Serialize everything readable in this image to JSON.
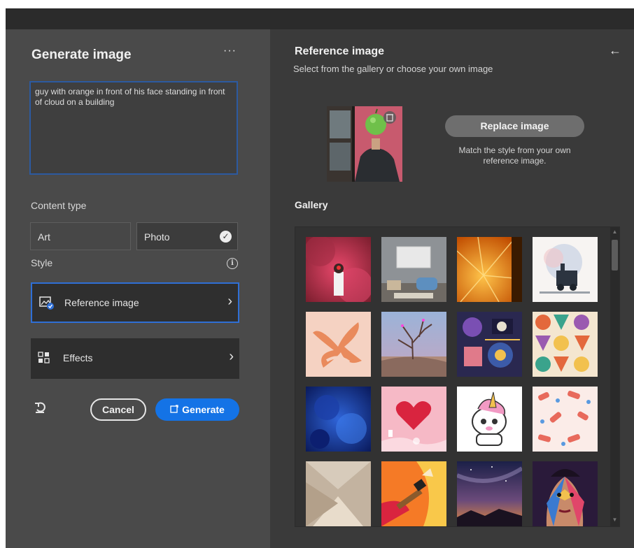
{
  "left_panel": {
    "title": "Generate image",
    "more_label": "···",
    "prompt_text": "guy with orange in front of his face standing in front of cloud on a building",
    "content_type_label": "Content type",
    "content_types": [
      {
        "label": "Art",
        "selected": false
      },
      {
        "label": "Photo",
        "selected": true
      }
    ],
    "style_label": "Style",
    "style_rows": [
      {
        "label": "Reference image",
        "icon": "reference-image-icon",
        "selected": true
      },
      {
        "label": "Effects",
        "icon": "effects-icon",
        "selected": false
      }
    ],
    "cancel_label": "Cancel",
    "generate_label": "Generate",
    "colors": {
      "accent": "#1473e6",
      "selection_border": "#2f6fd6"
    }
  },
  "right_panel": {
    "title": "Reference image",
    "subtitle": "Select from the gallery or choose your own image",
    "back_icon": "arrow-left-icon",
    "replace_label": "Replace image",
    "replace_help": "Match the style from your own reference image.",
    "gallery_label": "Gallery",
    "gallery_items": [
      {
        "name": "smoke-figure"
      },
      {
        "name": "room-interior"
      },
      {
        "name": "orange-slice"
      },
      {
        "name": "steam-train"
      },
      {
        "name": "coral-shapes"
      },
      {
        "name": "desert-tree"
      },
      {
        "name": "geometric-collage"
      },
      {
        "name": "pattern-tiles"
      },
      {
        "name": "blue-paint"
      },
      {
        "name": "heart-balloon"
      },
      {
        "name": "unicorn-cartoon"
      },
      {
        "name": "hand-pattern"
      },
      {
        "name": "paper-folds"
      },
      {
        "name": "paint-brush"
      },
      {
        "name": "night-sky"
      },
      {
        "name": "pop-portrait"
      }
    ]
  }
}
